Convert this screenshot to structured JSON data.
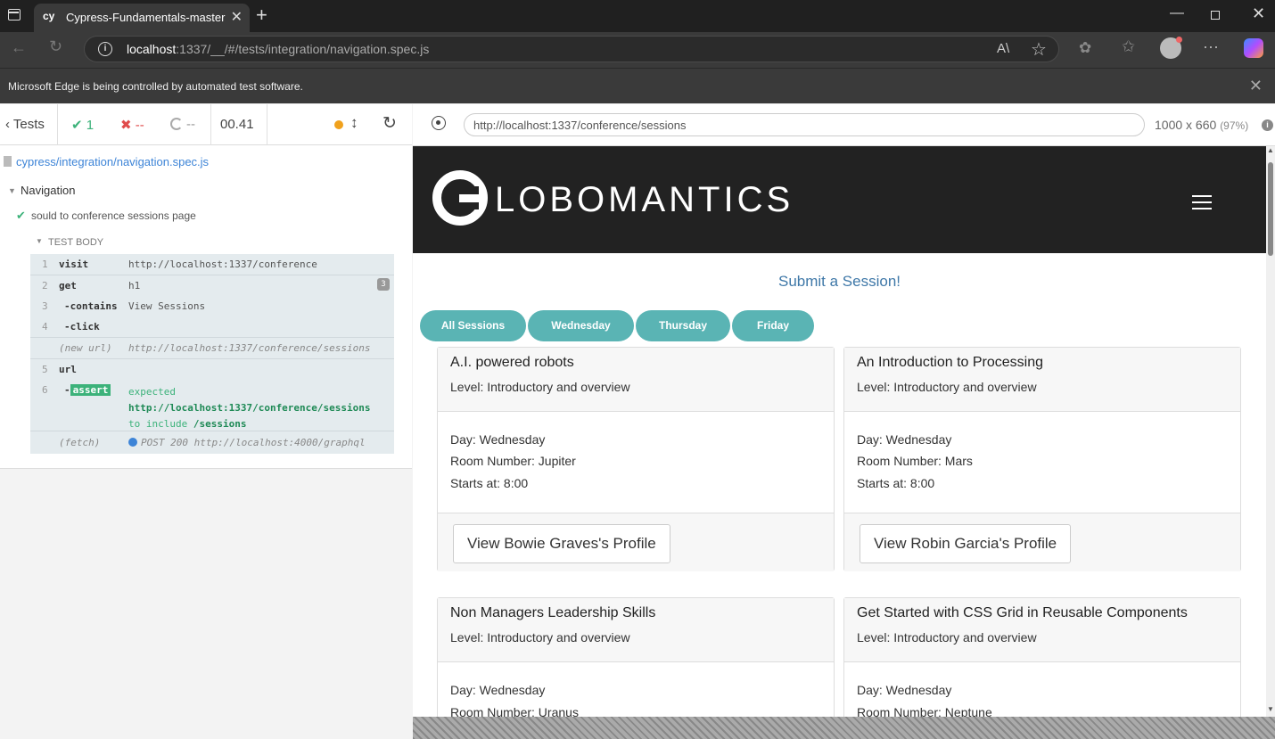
{
  "browser": {
    "tab_favicon": "cy",
    "tab_title": "Cypress-Fundamentals-master",
    "url_host": "localhost",
    "url_rest": ":1337/__/#/tests/integration/navigation.spec.js",
    "info_message": "Microsoft Edge is being controlled by automated test software."
  },
  "reporter": {
    "tests_label": "Tests",
    "passed": "1",
    "failed": "--",
    "pending": "--",
    "duration": "00.41",
    "spec_file": "cypress/integration/navigation.spec.js",
    "suite": "Navigation",
    "test": "sould to conference sessions page",
    "test_body_label": "TEST BODY",
    "commands": [
      {
        "num": "1",
        "name": "visit",
        "message": "http://localhost:1337/conference"
      },
      {
        "num": "2",
        "name": "get",
        "message": "h1",
        "badge": "3"
      },
      {
        "num": "3",
        "name": "-contains",
        "message": "View Sessions"
      },
      {
        "num": "4",
        "name": "-click",
        "message": ""
      },
      {
        "num": "",
        "name": "(new url)",
        "message": "http://localhost:1337/conference/sessions"
      },
      {
        "num": "5",
        "name": "url",
        "message": ""
      },
      {
        "num": "6",
        "name": "assert",
        "expected": "expected",
        "expected_url": "http://localhost:1337/conference/sessions",
        "include_text": "to include",
        "include_value": "/sessions"
      },
      {
        "num": "",
        "name": "(fetch)",
        "message": "POST 200 http://localhost:4000/graphql"
      }
    ]
  },
  "runner": {
    "url": "http://localhost:1337/conference/sessions",
    "viewport": "1000 x 660",
    "scale": "(97%)"
  },
  "app": {
    "brand": "LOBOMANTICS",
    "submit_link": "Submit a Session!",
    "filters": [
      "All Sessions",
      "Wednesday",
      "Thursday",
      "Friday"
    ],
    "sessions": [
      {
        "title": "A.I. powered robots",
        "level": "Level: Introductory and overview",
        "day": "Day: Wednesday",
        "room": "Room Number: Jupiter",
        "starts": "Starts at: 8:00",
        "profile": "View Bowie Graves's Profile"
      },
      {
        "title": "An Introduction to Processing",
        "level": "Level: Introductory and overview",
        "day": "Day: Wednesday",
        "room": "Room Number: Mars",
        "starts": "Starts at: 8:00",
        "profile": "View Robin Garcia's Profile"
      },
      {
        "title": "Non Managers Leadership Skills",
        "level": "Level: Introductory and overview",
        "day": "Day: Wednesday",
        "room": "Room Number: Uranus"
      },
      {
        "title": "Get Started with CSS Grid in Reusable Components",
        "level": "Level: Introductory and overview",
        "day": "Day: Wednesday",
        "room": "Room Number: Neptune"
      }
    ]
  },
  "colors": {
    "pill_teal": "#5ab4b4",
    "pass_green": "#3cb27a",
    "fail_red": "#e04c4c",
    "link_blue": "#3f78a8",
    "running_orange": "#f0a11d"
  }
}
